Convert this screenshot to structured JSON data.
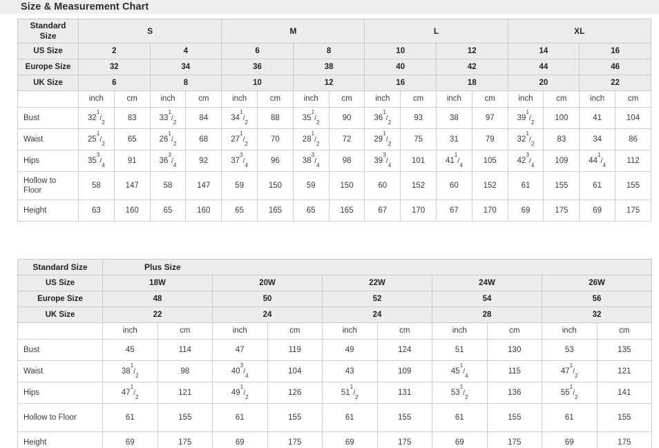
{
  "page": {
    "title": "Size & Measurement Chart",
    "title_band_color": "#efefef",
    "header_cell_color": "#ececec",
    "border_color": "#cfcfcf",
    "text_color": "#3a3a3a"
  },
  "standard_table": {
    "row_label_header": "Standard Size",
    "size_groups": [
      {
        "label": "S",
        "span": 4
      },
      {
        "label": "M",
        "span": 4
      },
      {
        "label": "L",
        "span": 4
      },
      {
        "label": "XL",
        "span": 4
      }
    ],
    "rows": [
      {
        "label": "US Size",
        "values": [
          "2",
          "4",
          "6",
          "8",
          "10",
          "12",
          "14",
          "16"
        ]
      },
      {
        "label": "Europe Size",
        "values": [
          "32",
          "34",
          "36",
          "38",
          "40",
          "42",
          "44",
          "46"
        ]
      },
      {
        "label": "UK Size",
        "values": [
          "6",
          "8",
          "10",
          "12",
          "16",
          "18",
          "20",
          "22"
        ]
      }
    ],
    "unit_row": {
      "label": "",
      "units": [
        "inch",
        "cm",
        "inch",
        "cm",
        "inch",
        "cm",
        "inch",
        "cm",
        "inch",
        "cm",
        "inch",
        "cm",
        "inch",
        "cm",
        "inch",
        "cm"
      ]
    },
    "measurements": [
      {
        "label": "Bust",
        "tall": false,
        "values": [
          {
            "whole": "32",
            "num": "1",
            "den": "2"
          },
          {
            "whole": "83"
          },
          {
            "whole": "33",
            "num": "1",
            "den": "2"
          },
          {
            "whole": "84"
          },
          {
            "whole": "34",
            "num": "1",
            "den": "2"
          },
          {
            "whole": "88"
          },
          {
            "whole": "35",
            "num": "1",
            "den": "2"
          },
          {
            "whole": "90"
          },
          {
            "whole": "36",
            "num": "1",
            "den": "2"
          },
          {
            "whole": "93"
          },
          {
            "whole": "38"
          },
          {
            "whole": "97"
          },
          {
            "whole": "39",
            "num": "1",
            "den": "2"
          },
          {
            "whole": "100"
          },
          {
            "whole": "41"
          },
          {
            "whole": "104"
          }
        ]
      },
      {
        "label": "Waist",
        "tall": false,
        "values": [
          {
            "whole": "25",
            "num": "1",
            "den": "2"
          },
          {
            "whole": "65"
          },
          {
            "whole": "26",
            "num": "1",
            "den": "2"
          },
          {
            "whole": "68"
          },
          {
            "whole": "27",
            "num": "1",
            "den": "2"
          },
          {
            "whole": "70"
          },
          {
            "whole": "28",
            "num": "1",
            "den": "2"
          },
          {
            "whole": "72"
          },
          {
            "whole": "29",
            "num": "1",
            "den": "2"
          },
          {
            "whole": "75"
          },
          {
            "whole": "31"
          },
          {
            "whole": "79"
          },
          {
            "whole": "32",
            "num": "1",
            "den": "2"
          },
          {
            "whole": "83"
          },
          {
            "whole": "34"
          },
          {
            "whole": "86"
          }
        ]
      },
      {
        "label": "Hips",
        "tall": false,
        "values": [
          {
            "whole": "35",
            "num": "3",
            "den": "4"
          },
          {
            "whole": "91"
          },
          {
            "whole": "36",
            "num": "3",
            "den": "4"
          },
          {
            "whole": "92"
          },
          {
            "whole": "37",
            "num": "3",
            "den": "4"
          },
          {
            "whole": "96"
          },
          {
            "whole": "38",
            "num": "3",
            "den": "4"
          },
          {
            "whole": "98"
          },
          {
            "whole": "39",
            "num": "3",
            "den": "4"
          },
          {
            "whole": "101"
          },
          {
            "whole": "41",
            "num": "1",
            "den": "4"
          },
          {
            "whole": "105"
          },
          {
            "whole": "42",
            "num": "3",
            "den": "4"
          },
          {
            "whole": "109"
          },
          {
            "whole": "44",
            "num": "1",
            "den": "4"
          },
          {
            "whole": "112"
          }
        ]
      },
      {
        "label": "Hollow to Floor",
        "tall": true,
        "values": [
          {
            "whole": "58"
          },
          {
            "whole": "147"
          },
          {
            "whole": "58"
          },
          {
            "whole": "147"
          },
          {
            "whole": "59"
          },
          {
            "whole": "150"
          },
          {
            "whole": "59"
          },
          {
            "whole": "150"
          },
          {
            "whole": "60"
          },
          {
            "whole": "152"
          },
          {
            "whole": "60"
          },
          {
            "whole": "152"
          },
          {
            "whole": "61"
          },
          {
            "whole": "155"
          },
          {
            "whole": "61"
          },
          {
            "whole": "155"
          }
        ]
      },
      {
        "label": "Height",
        "tall": false,
        "values": [
          {
            "whole": "63"
          },
          {
            "whole": "160"
          },
          {
            "whole": "65"
          },
          {
            "whole": "160"
          },
          {
            "whole": "65"
          },
          {
            "whole": "165"
          },
          {
            "whole": "65"
          },
          {
            "whole": "165"
          },
          {
            "whole": "67"
          },
          {
            "whole": "170"
          },
          {
            "whole": "67"
          },
          {
            "whole": "170"
          },
          {
            "whole": "69"
          },
          {
            "whole": "175"
          },
          {
            "whole": "69"
          },
          {
            "whole": "175"
          }
        ]
      }
    ]
  },
  "plus_table": {
    "row_label_header": "Standard Size",
    "group_label": "Plus Size",
    "rows": [
      {
        "label": "US Size",
        "values": [
          "18W",
          "20W",
          "22W",
          "24W",
          "26W"
        ]
      },
      {
        "label": "Europe Size",
        "values": [
          "48",
          "50",
          "52",
          "54",
          "56"
        ]
      },
      {
        "label": "UK Size",
        "values": [
          "22",
          "24",
          "24",
          "28",
          "32"
        ]
      }
    ],
    "unit_row": {
      "label": "",
      "units": [
        "inch",
        "cm",
        "inch",
        "cm",
        "inch",
        "cm",
        "inch",
        "cm",
        "inch",
        "cm"
      ]
    },
    "measurements": [
      {
        "label": "Bust",
        "values": [
          {
            "whole": "45"
          },
          {
            "whole": "114"
          },
          {
            "whole": "47"
          },
          {
            "whole": "119"
          },
          {
            "whole": "49"
          },
          {
            "whole": "124"
          },
          {
            "whole": "51"
          },
          {
            "whole": "130"
          },
          {
            "whole": "53"
          },
          {
            "whole": "135"
          }
        ]
      },
      {
        "label": "Waist",
        "values": [
          {
            "whole": "38",
            "num": "1",
            "den": "2"
          },
          {
            "whole": "98"
          },
          {
            "whole": "40",
            "num": "3",
            "den": "4"
          },
          {
            "whole": "104"
          },
          {
            "whole": "43"
          },
          {
            "whole": "109"
          },
          {
            "whole": "45",
            "num": "1",
            "den": "4"
          },
          {
            "whole": "115"
          },
          {
            "whole": "47",
            "num": "1",
            "den": "2"
          },
          {
            "whole": "121"
          }
        ]
      },
      {
        "label": "Hips",
        "values": [
          {
            "whole": "47",
            "num": "1",
            "den": "2"
          },
          {
            "whole": "121"
          },
          {
            "whole": "49",
            "num": "1",
            "den": "2"
          },
          {
            "whole": "126"
          },
          {
            "whole": "51",
            "num": "1",
            "den": "2"
          },
          {
            "whole": "131"
          },
          {
            "whole": "53",
            "num": "1",
            "den": "2"
          },
          {
            "whole": "136"
          },
          {
            "whole": "55",
            "num": "1",
            "den": "2"
          },
          {
            "whole": "141"
          }
        ]
      },
      {
        "label": "Hollow to Floor",
        "values": [
          {
            "whole": "61"
          },
          {
            "whole": "155"
          },
          {
            "whole": "61"
          },
          {
            "whole": "155"
          },
          {
            "whole": "61"
          },
          {
            "whole": "155"
          },
          {
            "whole": "61"
          },
          {
            "whole": "155"
          },
          {
            "whole": "61"
          },
          {
            "whole": "155"
          }
        ]
      },
      {
        "label": "Height",
        "values": [
          {
            "whole": "69"
          },
          {
            "whole": "175"
          },
          {
            "whole": "69"
          },
          {
            "whole": "175"
          },
          {
            "whole": "69"
          },
          {
            "whole": "175"
          },
          {
            "whole": "69"
          },
          {
            "whole": "175"
          },
          {
            "whole": "69"
          },
          {
            "whole": "175"
          }
        ]
      }
    ]
  }
}
